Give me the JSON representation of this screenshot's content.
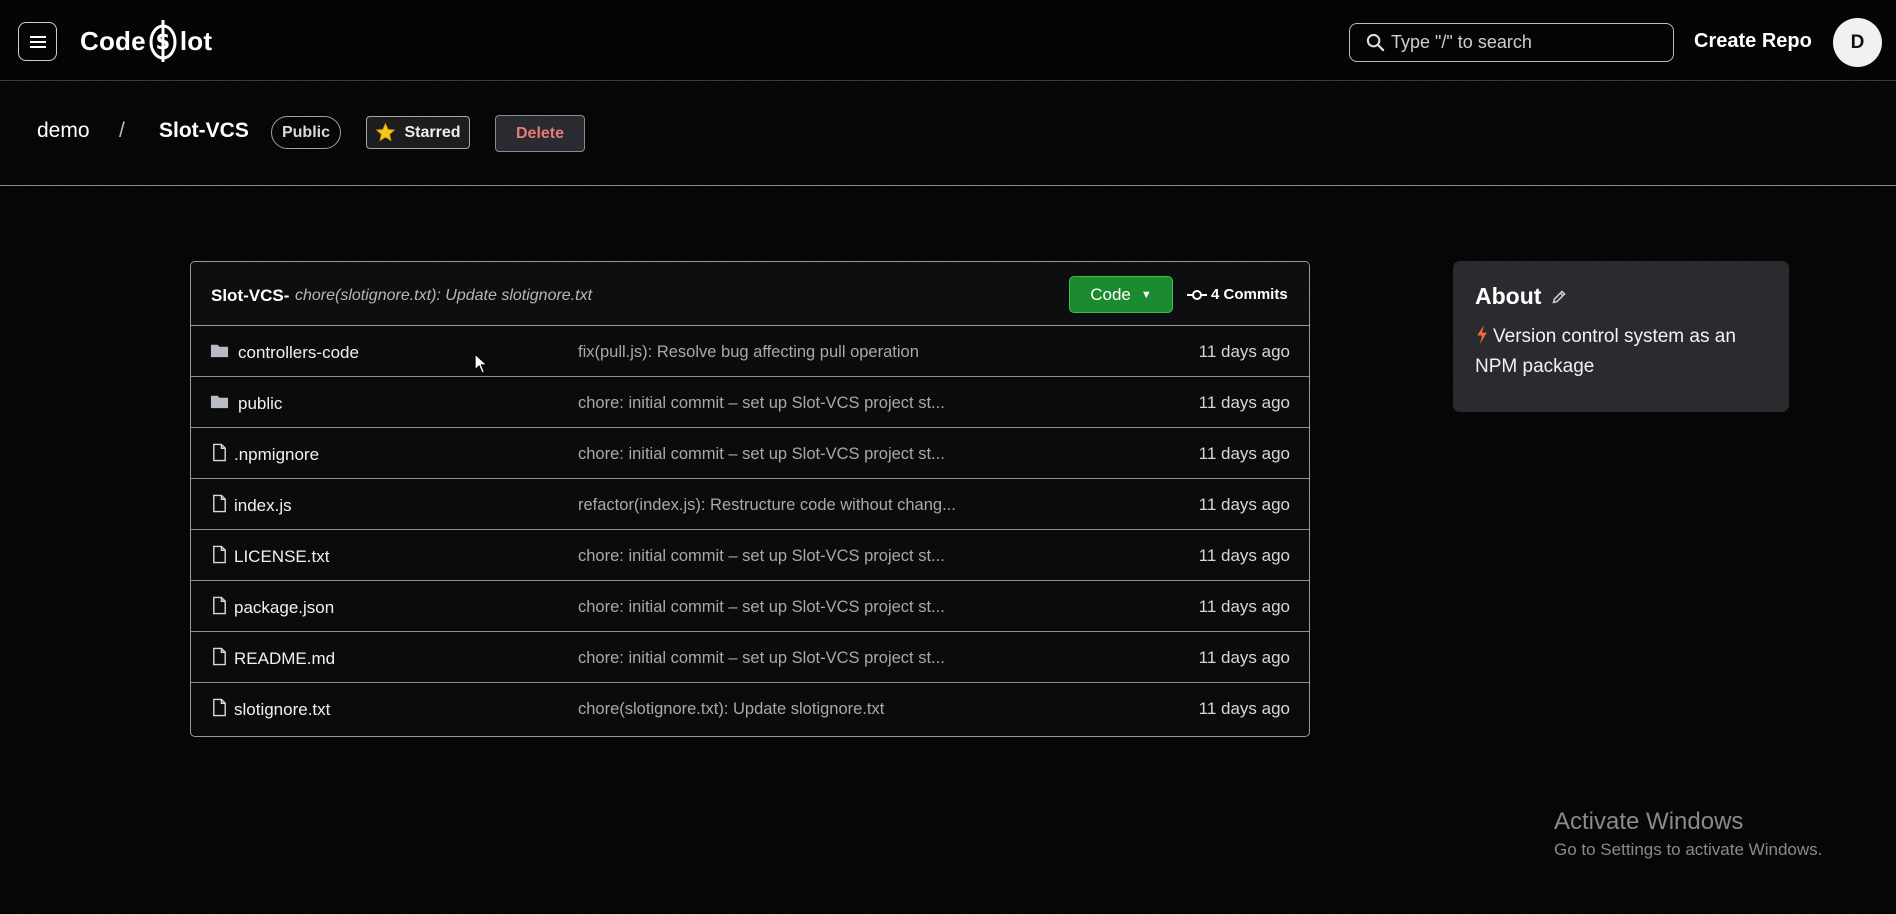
{
  "nav": {
    "logo_left": "Code",
    "logo_right": "lot",
    "search_placeholder": "Type \"/\" to search",
    "create_repo": "Create Repo",
    "avatar_initial": "D"
  },
  "repo": {
    "owner": "demo",
    "separator": "/",
    "name": "Slot-VCS",
    "visibility": "Public",
    "star_label": "Starred",
    "delete_label": "Delete"
  },
  "files_header": {
    "repo_label": "Slot-VCS-",
    "last_commit": "chore(slotignore.txt): Update slotignore.txt",
    "code_button": "Code",
    "commits_label": "4 Commits"
  },
  "files": [
    {
      "type": "dir",
      "name": "controllers-code",
      "message": "fix(pull.js): Resolve bug affecting pull operation",
      "time": "11 days ago"
    },
    {
      "type": "dir",
      "name": "public",
      "message": "chore: initial commit – set up Slot-VCS project st...",
      "time": "11 days ago"
    },
    {
      "type": "file",
      "name": ".npmignore",
      "message": "chore: initial commit – set up Slot-VCS project st...",
      "time": "11 days ago"
    },
    {
      "type": "file",
      "name": "index.js",
      "message": "refactor(index.js): Restructure code without chang...",
      "time": "11 days ago"
    },
    {
      "type": "file",
      "name": "LICENSE.txt",
      "message": "chore: initial commit – set up Slot-VCS project st...",
      "time": "11 days ago"
    },
    {
      "type": "file",
      "name": "package.json",
      "message": "chore: initial commit – set up Slot-VCS project st...",
      "time": "11 days ago"
    },
    {
      "type": "file",
      "name": "README.md",
      "message": "chore: initial commit – set up Slot-VCS project st...",
      "time": "11 days ago"
    },
    {
      "type": "file",
      "name": "slotignore.txt",
      "message": "chore(slotignore.txt): Update slotignore.txt",
      "time": "11 days ago"
    }
  ],
  "about": {
    "title": "About",
    "description": "Version control system as an NPM package"
  },
  "watermark": {
    "title": "Activate Windows",
    "subtitle": "Go to Settings to activate Windows."
  },
  "colors": {
    "code_button": "#1c8a2e",
    "delete_text": "#e87a7a",
    "star": "#f5c518",
    "bolt": "#f06a3c"
  }
}
